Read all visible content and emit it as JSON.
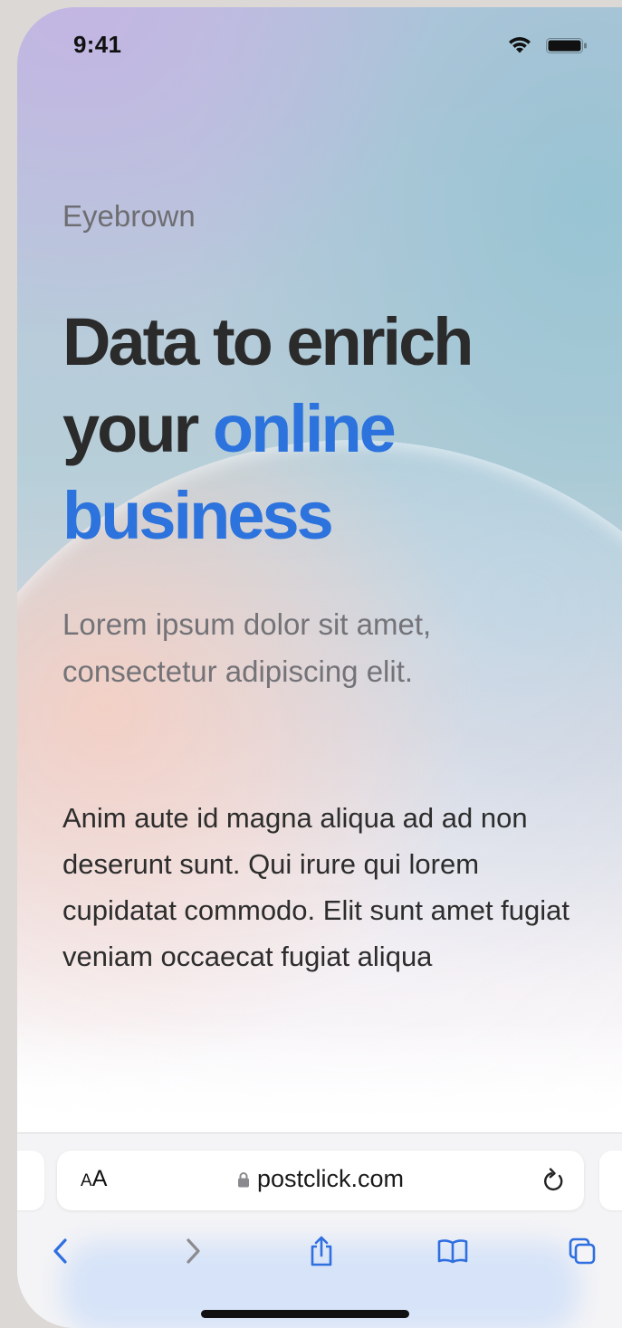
{
  "status_bar": {
    "time": "9:41"
  },
  "hero": {
    "eyebrow": "Eyebrown",
    "headline_part1": "Data to enrich your ",
    "headline_highlight": "online business",
    "lede": "Lorem ipsum dolor sit amet, consectetur adipiscing elit.",
    "body": "Anim aute id magna aliqua ad ad non deserunt sunt. Qui irure qui lorem cupidatat commodo. Elit sunt amet fugiat veniam occaecat fugiat aliqua"
  },
  "browser": {
    "text_size_small": "A",
    "text_size_large": "A",
    "url": "postclick.com",
    "icons": [
      "lock-icon",
      "reload-icon",
      "back-icon",
      "forward-icon",
      "share-icon",
      "bookmarks-icon",
      "tabs-icon"
    ]
  },
  "colors": {
    "headline": "#2b2b2b",
    "accent": "#2d73dd",
    "eyebrow": "#6e6e72",
    "toolbar_icon": "#2f6fe0"
  }
}
